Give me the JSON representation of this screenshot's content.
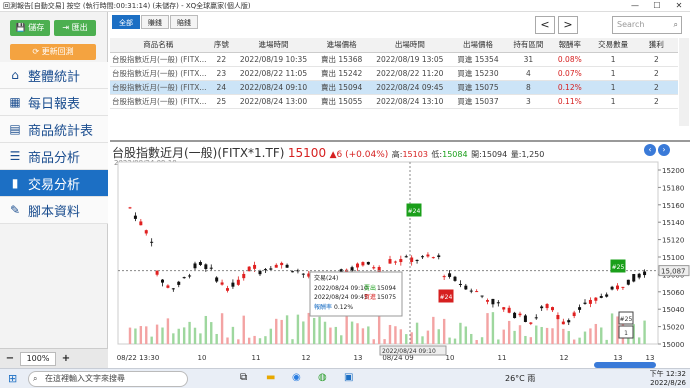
{
  "window": {
    "title": "回測報告[自動交易] 按空 (執行時間:00:31:14) (未儲存) - XQ全球贏家(個人版)"
  },
  "sidebar": {
    "save": "儲存",
    "logout": "匯出",
    "refresh": "更新回測",
    "items": [
      {
        "label": "整體統計",
        "icon": "home-icon"
      },
      {
        "label": "每日報表",
        "icon": "calendar-icon"
      },
      {
        "label": "商品統計表",
        "icon": "list-icon"
      },
      {
        "label": "商品分析",
        "icon": "table-icon"
      },
      {
        "label": "交易分析",
        "icon": "bar-chart-icon",
        "active": true
      },
      {
        "label": "腳本資料",
        "icon": "pencil-icon"
      }
    ],
    "zoom": "100%"
  },
  "main": {
    "tabs": [
      "全部",
      "賺錢",
      "賠錢"
    ],
    "search_placeholder": "Search",
    "columns": [
      "商品名稱",
      "序號",
      "進場時間",
      "進場價格",
      "出場時間",
      "出場價格",
      "持有區間",
      "報酬率",
      "交易數量",
      "獲利"
    ],
    "rows": [
      [
        "台股指數近月(一般) (FITX...",
        "22",
        "2022/08/19 10:35",
        "賣出 15368",
        "2022/08/19 13:05",
        "買進 15354",
        "31",
        "0.08%",
        "1",
        "2"
      ],
      [
        "台股指數近月(一般) (FITX...",
        "23",
        "2022/08/22 11:05",
        "賣出 15242",
        "2022/08/22 11:20",
        "買進 15230",
        "4",
        "0.07%",
        "1",
        "2"
      ],
      [
        "台股指數近月(一般) (FITX...",
        "24",
        "2022/08/24 09:10",
        "賣出 15094",
        "2022/08/24 09:45",
        "買進 15075",
        "8",
        "0.12%",
        "1",
        "2"
      ],
      [
        "台股指數近月(一般) (FITX...",
        "25",
        "2022/08/24 13:00",
        "賣出 15055",
        "2022/08/24 13:10",
        "買進 15037",
        "3",
        "0.11%",
        "1",
        "2"
      ]
    ]
  },
  "chart_header": {
    "name": "台股指數近月(一般)(FITX*1.TF)",
    "price": "15100",
    "change": "▲6 (+0.04%)",
    "high_label": "高:",
    "high": "15103",
    "low_label": "低:",
    "low": "15084",
    "open_label": "開:",
    "open": "15094",
    "vol_label": "量:",
    "vol": "1,250",
    "date_corner": "2022/08/24 09:10"
  },
  "tooltip": {
    "title": "交易(24)",
    "line1_time": "2022/08/24 09:10",
    "line1_side": "賣出",
    "line1_price": "15094",
    "line2_time": "2022/08/24 09:45",
    "line2_side": "買進",
    "line2_price": "15075",
    "ret_label": "報酬率",
    "ret": "0.12%"
  },
  "chart_data": {
    "type": "candlestick",
    "ylim": [
      14990,
      15220
    ],
    "y_ticks": [
      "15200",
      "15180",
      "15160",
      "15140",
      "15120",
      "15100",
      "15080",
      "15060",
      "15040",
      "15020",
      "15000"
    ],
    "x_ticks": [
      "08/22 13:30",
      "10",
      "11",
      "12",
      "13",
      "08/24 09",
      "10",
      "11",
      "12",
      "13",
      "13"
    ],
    "crosshair_y_label": "15,087",
    "crosshair_x_label": "2022/08/24 09:10",
    "markers": [
      {
        "label": "#24",
        "color": "#1a9f1a"
      },
      {
        "label": "#24",
        "color": "#d62020"
      },
      {
        "label": "#25",
        "color": "#1a9f1a"
      },
      {
        "label": "#25",
        "color": "#444"
      },
      {
        "label": "1",
        "color": "#444"
      }
    ]
  },
  "taskbar": {
    "search": "在這裡輸入文字來搜尋",
    "weather": "26°C 雨",
    "time": "下午 12:32",
    "date": "2022/8/26"
  }
}
